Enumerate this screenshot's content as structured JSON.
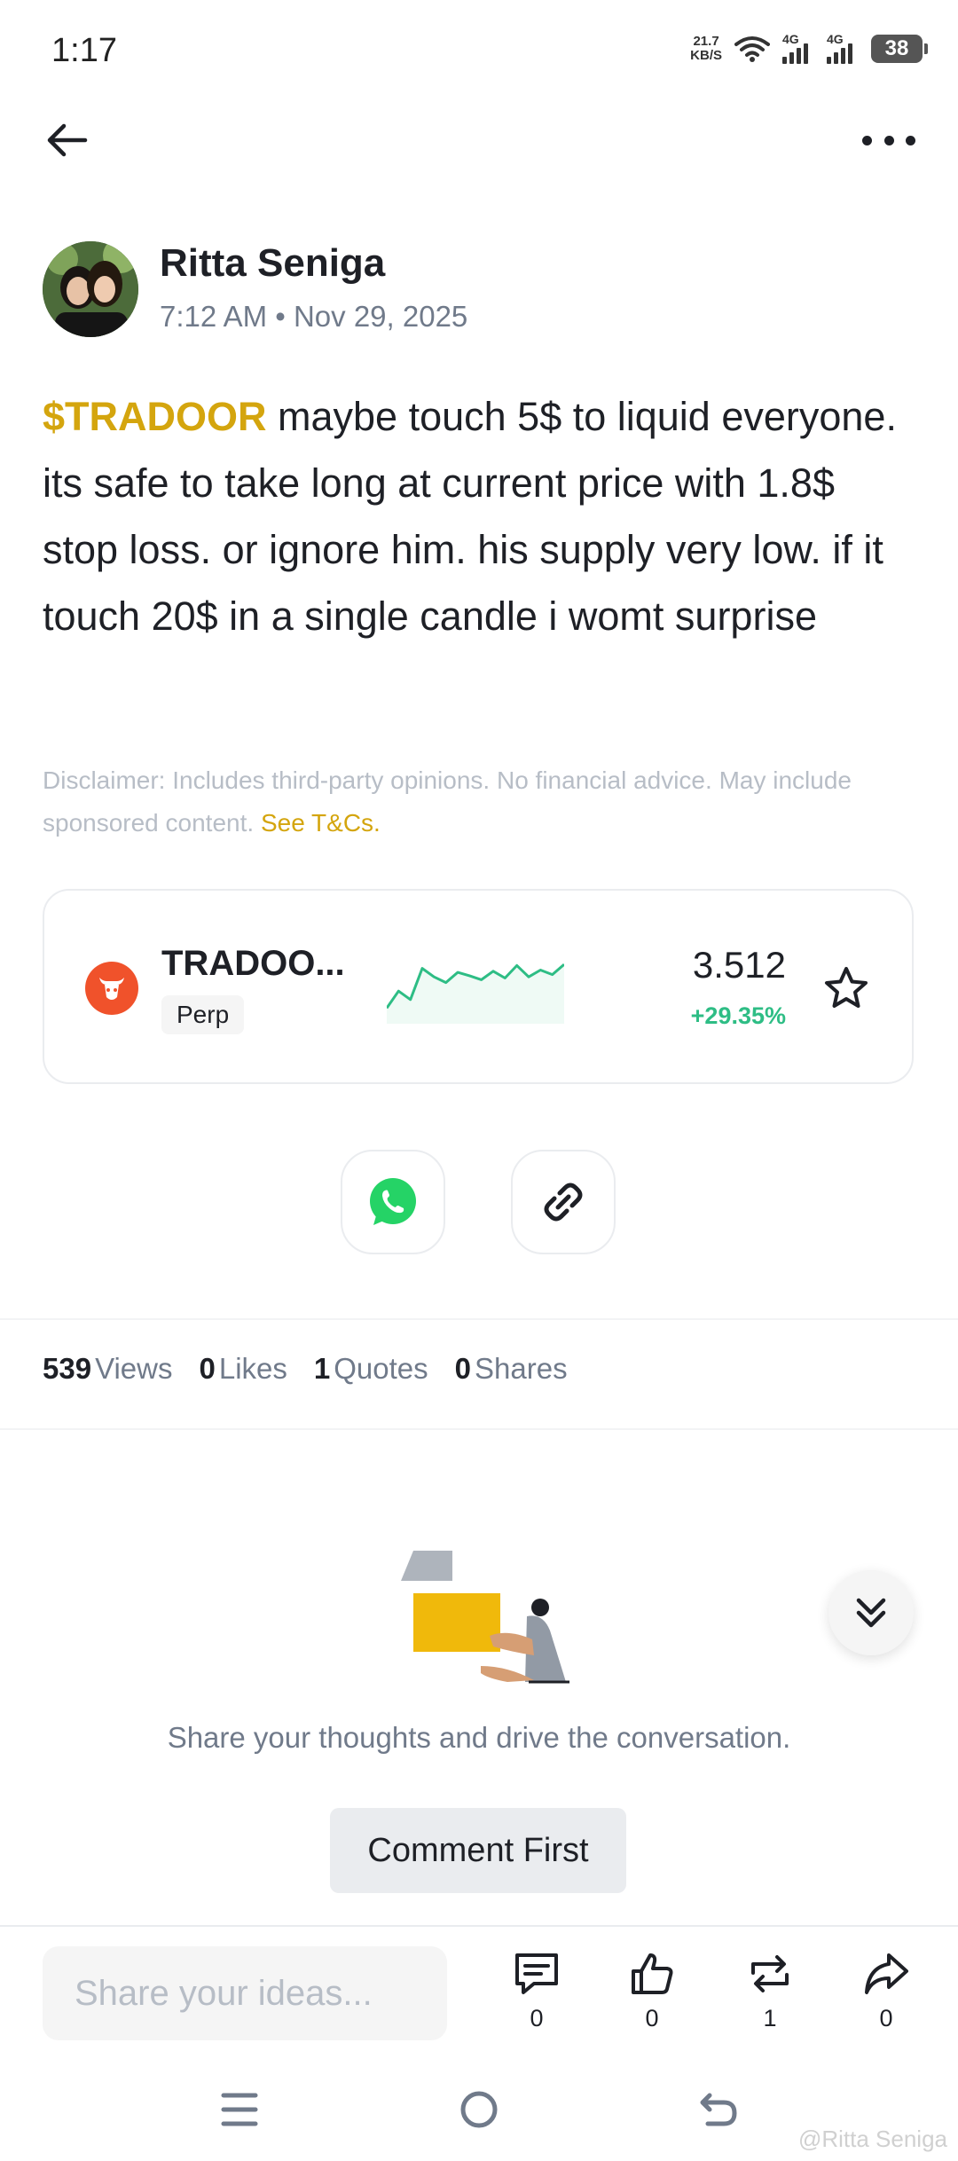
{
  "status_bar": {
    "time": "1:17",
    "net_speed_value": "21.7",
    "net_speed_unit": "KB/S",
    "signal_1_label": "4G",
    "signal_2_label": "4G",
    "battery": "38"
  },
  "nav": {
    "back_icon": "arrow-left-icon",
    "more_icon": "more-horizontal-icon"
  },
  "author": {
    "name": "Ritta Seniga",
    "timestamp": "7:12 AM • Nov 29, 2025"
  },
  "post": {
    "ticker": "$TRADOOR",
    "body": " maybe touch 5$ to liquid everyone. its safe to take long at current price  with 1.8$ stop loss.  or ignore him. his supply very low. if it touch 20$ in a single candle i womt surprise"
  },
  "disclaimer": {
    "text": "Disclaimer: Includes third-party opinions. No financial advice. May include sponsored content.",
    "link": "See T&Cs."
  },
  "token_card": {
    "name": "TRADOO...",
    "badge": "Perp",
    "price": "3.512",
    "change": "+29.35%",
    "change_color": "#2ebd85",
    "logo_color": "#f0522b",
    "icon": "star-outline-icon",
    "sparkline": [
      0.15,
      0.45,
      0.3,
      0.85,
      0.7,
      0.6,
      0.78,
      0.72,
      0.65,
      0.8,
      0.68,
      0.9,
      0.7,
      0.82,
      0.74,
      0.92
    ]
  },
  "share": {
    "whatsapp_icon": "whatsapp-icon",
    "link_icon": "link-icon"
  },
  "stats": [
    {
      "value": "539",
      "label": "Views"
    },
    {
      "value": "0",
      "label": "Likes"
    },
    {
      "value": "1",
      "label": "Quotes"
    },
    {
      "value": "0",
      "label": "Shares"
    }
  ],
  "empty_state": {
    "text": "Share your thoughts and drive the conversation.",
    "button": "Comment First"
  },
  "bottom_bar": {
    "placeholder": "Share your ideas...",
    "actions": [
      {
        "icon": "comment-icon",
        "count": "0"
      },
      {
        "icon": "thumbs-up-icon",
        "count": "0"
      },
      {
        "icon": "repost-icon",
        "count": "1"
      },
      {
        "icon": "share-arrow-icon",
        "count": "0"
      }
    ]
  },
  "watermark": "@Ritta Seniga",
  "colors": {
    "accent": "#d4a50e",
    "text": "#1e2026",
    "secondary": "#707a8a",
    "positive": "#2ebd85"
  }
}
